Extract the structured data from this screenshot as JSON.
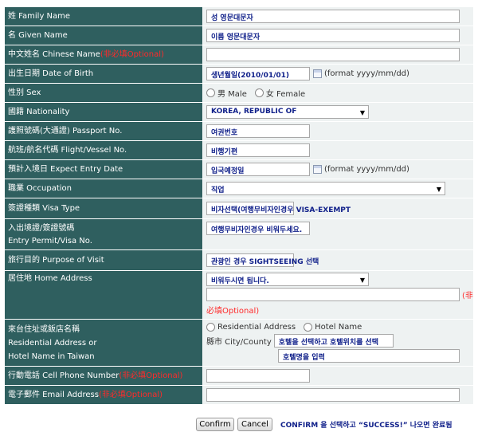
{
  "rows": {
    "family_name": {
      "label": "姓 Family Name",
      "value": "성 영문대문자"
    },
    "given_name": {
      "label": "名 Given Name",
      "value": "이름 영문대문자"
    },
    "chinese_name": {
      "label": "中文姓名 Chinese Name",
      "optional": "(非必填Optional)",
      "value": ""
    },
    "birth_date": {
      "label": "出生日期 Date of Birth",
      "value": "생년월일(2010/01/01)",
      "format_hint": "(format yyyy/mm/dd)"
    },
    "sex": {
      "label": "性別 Sex",
      "option_male": "男 Male",
      "option_female": "女 Female"
    },
    "nationality": {
      "label": "國籍 Nationality",
      "value": "KOREA, REPUBLIC OF"
    },
    "passport": {
      "label": "護照號碼(大通證) Passport No.",
      "value": "여권번호"
    },
    "flight": {
      "label": "航班/航名代碼 Flight/Vessel No.",
      "value": "비행기편"
    },
    "entry_date": {
      "label": "預計入境日 Expect Entry Date",
      "value": "입국예정일",
      "format_hint": "(format yyyy/mm/dd)"
    },
    "occupation": {
      "label": "職業 Occupation",
      "value": "직업"
    },
    "visa_type": {
      "label": "簽證種類 Visa Type",
      "value": "비자선택(여행무비자인경우 VISA-EXEMPT"
    },
    "entry_permit": {
      "label_line1": "入出境證/簽證號碼",
      "label_line2": "Entry Permit/Visa No.",
      "value": "여행무비자인경우 비워두세요."
    },
    "purpose": {
      "label": "旅行目的 Purpose of Visit",
      "value": "관광인 경우 SIGHTSEEING 선택"
    },
    "home_address": {
      "label": "居住地 Home Address",
      "value": "비워두시면 됩니다.",
      "optional_part1": "(非",
      "optional_part2": "必填Optional)"
    },
    "residential": {
      "label_line1": "來台住址或飯店名稱",
      "label_line2": "Residential Address or",
      "label_line3": "Hotel Name in Taiwan",
      "option_residential": "Residential Address",
      "option_hotel": "Hotel Name",
      "city_label": "縣市 City/County",
      "city_value": "호텔을 선택하고 호텔위치를 선택",
      "hotel_value": "호텔명을 입력"
    },
    "phone": {
      "label": "行動電話 Cell Phone Number",
      "optional": "(非必填Optional)",
      "value": ""
    },
    "email": {
      "label": "電子郵件 Email Address",
      "optional": "(非必填Optional)",
      "value": ""
    }
  },
  "buttons": {
    "confirm": "Confirm",
    "cancel": "Cancel"
  },
  "note": "CONFIRM 을 선택하고 “SUCCESS!” 나오면 완료됨",
  "colors": {
    "label_bg": "#2f5f5f",
    "field_bg": "#eef2f2",
    "annotation": "#10208a",
    "optional": "#ff2a2a"
  }
}
